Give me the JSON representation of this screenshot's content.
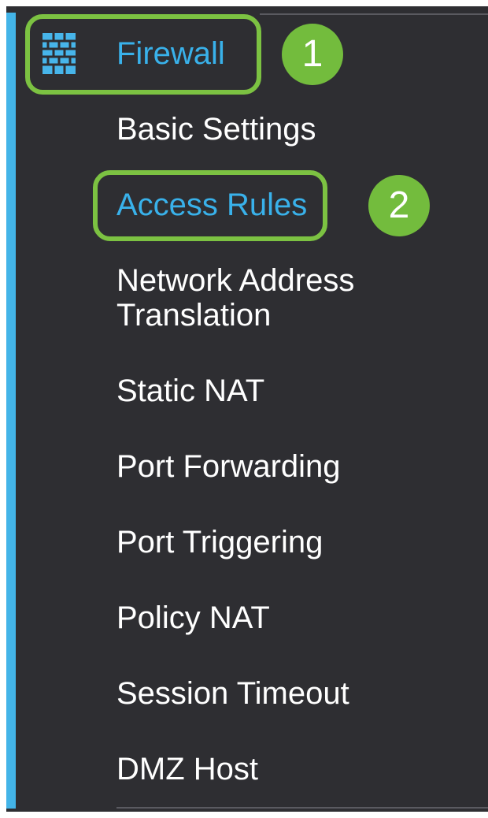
{
  "sidebar": {
    "section": {
      "label": "Firewall",
      "icon": "firewall-icon"
    },
    "items": [
      {
        "label": "Basic Settings"
      },
      {
        "label": "Access Rules",
        "active": true
      },
      {
        "label": "Network Address",
        "label_line2": "Translation"
      },
      {
        "label": "Static NAT"
      },
      {
        "label": "Port Forwarding"
      },
      {
        "label": "Port Triggering"
      },
      {
        "label": "Policy NAT"
      },
      {
        "label": "Session Timeout"
      },
      {
        "label": "DMZ Host"
      }
    ]
  },
  "callouts": {
    "one": "1",
    "two": "2"
  },
  "colors": {
    "panel_background": "#2e2e32",
    "active_text": "#39b1ea",
    "highlight_ring": "#7cc242",
    "callout_fill": "#73bc3d",
    "accent_bar": "#43b4e8",
    "text": "#ffffff"
  }
}
